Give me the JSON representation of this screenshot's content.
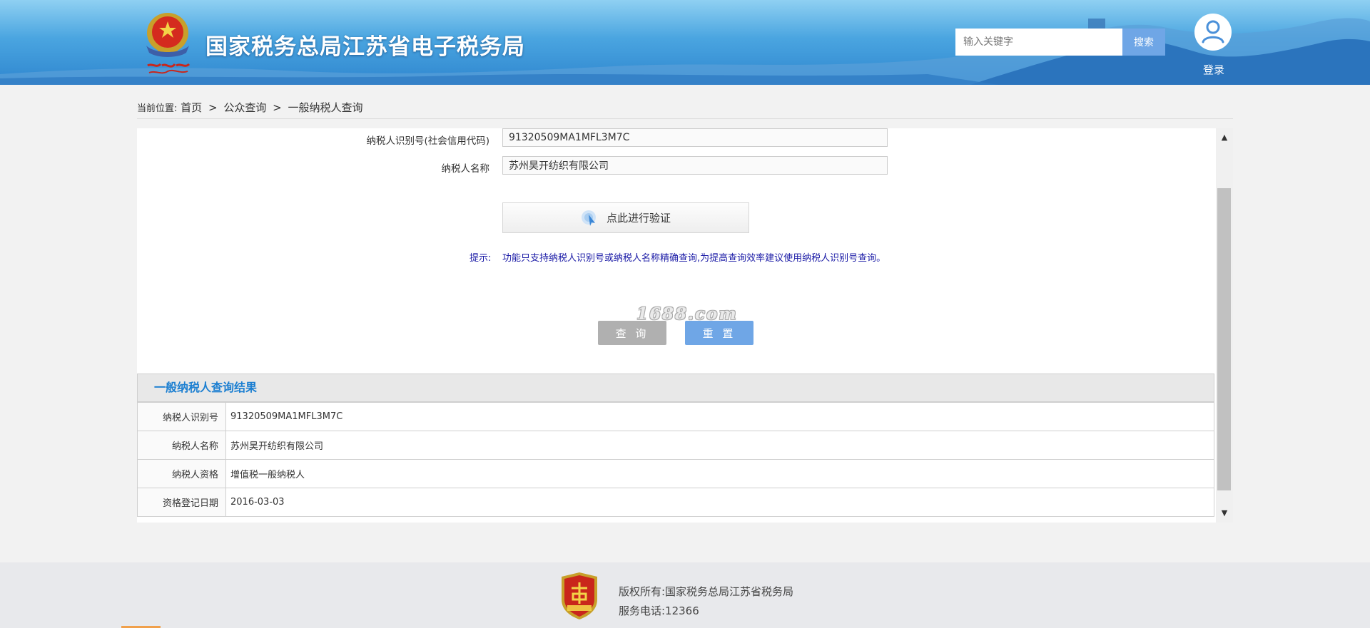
{
  "header": {
    "site_title": "国家税务总局江苏省电子税务局",
    "search_placeholder": "输入关键字",
    "search_button": "搜索",
    "login_label": "登录",
    "emblem_icon": "tax-emblem-icon",
    "avatar_icon": "user-avatar-icon"
  },
  "breadcrumb": {
    "prefix": "当前位置:",
    "items": [
      "首页",
      "公众查询",
      "一般纳税人查询"
    ],
    "separator": ">"
  },
  "form": {
    "id_label": "纳税人识别号(社会信用代码)",
    "id_value": "91320509MA1MFL3M7C",
    "name_label": "纳税人名称",
    "name_value": "苏州昊开纺织有限公司",
    "verify_button": "点此进行验证",
    "verify_icon": "cursor-click-icon",
    "hint_label": "提示:",
    "hint_text": "功能只支持纳税人识别号或纳税人名称精确查询,为提高查询效率建议使用纳税人识别号查询。",
    "watermark": "1688.com",
    "query_button": "查 询",
    "reset_button": "重 置"
  },
  "result": {
    "title": "一般纳税人查询结果",
    "rows": [
      {
        "label": "纳税人识别号",
        "value": "91320509MA1MFL3M7C"
      },
      {
        "label": "纳税人名称",
        "value": "苏州昊开纺织有限公司"
      },
      {
        "label": "纳税人资格",
        "value": "增值税一般纳税人"
      },
      {
        "label": "资格登记日期",
        "value": "2016-03-03"
      }
    ]
  },
  "footer": {
    "copyright": "版权所有:国家税务总局江苏省税务局",
    "phone": "服务电话:12366",
    "badge_icon": "government-agency-badge-icon"
  },
  "colors": {
    "header_blue": "#3a93d6",
    "accent_blue": "#6fa6e6",
    "result_title": "#1c7fd1",
    "hint_text": "#1a1aa6"
  }
}
